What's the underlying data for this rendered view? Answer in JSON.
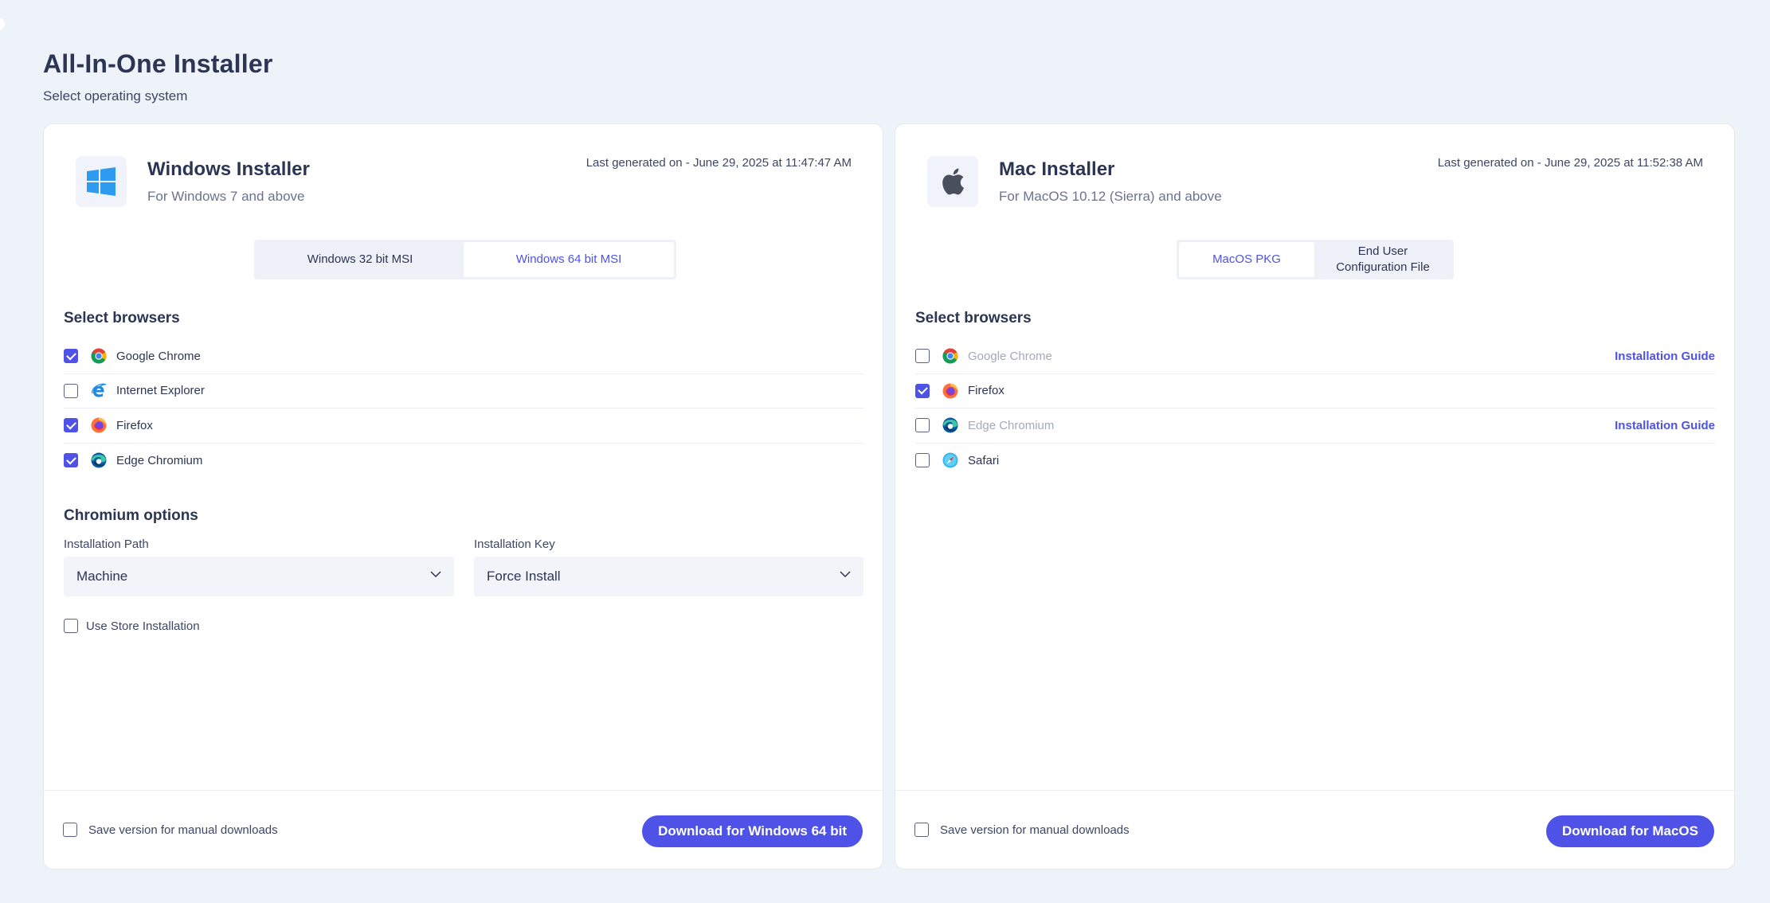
{
  "page": {
    "title": "All-In-One Installer",
    "subtitle": "Select operating system"
  },
  "windows": {
    "title": "Windows Installer",
    "subtitle": "For Windows 7 and above",
    "generated": "Last generated on - June 29, 2025 at 11:47:47 AM",
    "icon": "windows-logo-icon",
    "tabs": [
      {
        "label": "Windows 32 bit MSI",
        "active": false
      },
      {
        "label": "Windows 64 bit MSI",
        "active": true
      }
    ],
    "browsers_label": "Select browsers",
    "browsers": [
      {
        "name": "Google Chrome",
        "checked": true,
        "icon": "chrome-icon"
      },
      {
        "name": "Internet Explorer",
        "checked": false,
        "icon": "internet-explorer-icon"
      },
      {
        "name": "Firefox",
        "checked": true,
        "icon": "firefox-icon"
      },
      {
        "name": "Edge Chromium",
        "checked": true,
        "icon": "edge-icon"
      }
    ],
    "chromium_label": "Chromium options",
    "install_path_label": "Installation Path",
    "install_path_value": "Machine",
    "install_key_label": "Installation Key",
    "install_key_value": "Force Install",
    "store_install_label": "Use Store Installation",
    "store_install_checked": false,
    "save_version_label": "Save version for manual downloads",
    "save_version_checked": false,
    "download_label": "Download for Windows 64 bit"
  },
  "mac": {
    "title": "Mac Installer",
    "subtitle": "For MacOS 10.12 (Sierra) and above",
    "generated": "Last generated on - June 29, 2025 at 11:52:38 AM",
    "icon": "apple-logo-icon",
    "tabs": [
      {
        "label": "MacOS PKG",
        "active": true
      },
      {
        "label": "End User\nConfiguration File",
        "active": false
      }
    ],
    "browsers_label": "Select browsers",
    "browsers": [
      {
        "name": "Google Chrome",
        "checked": false,
        "disabled": true,
        "icon": "chrome-icon",
        "guide": "Installation Guide"
      },
      {
        "name": "Firefox",
        "checked": true,
        "disabled": false,
        "icon": "firefox-icon"
      },
      {
        "name": "Edge Chromium",
        "checked": false,
        "disabled": true,
        "icon": "edge-icon",
        "guide": "Installation Guide"
      },
      {
        "name": "Safari",
        "checked": false,
        "disabled": false,
        "icon": "safari-icon"
      }
    ],
    "save_version_label": "Save version for manual downloads",
    "save_version_checked": false,
    "download_label": "Download for MacOS"
  },
  "colors": {
    "accent": "#4f52e6",
    "background": "#eef2f9",
    "text": "#2c3553"
  }
}
